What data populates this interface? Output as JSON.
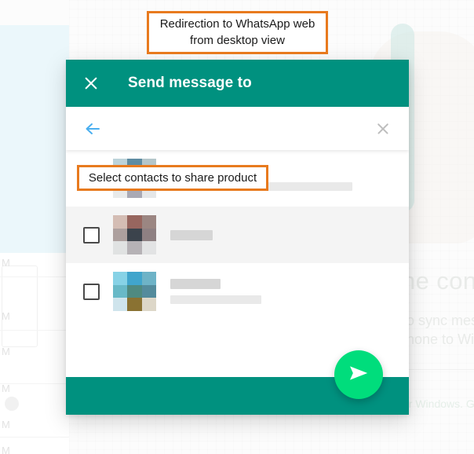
{
  "annotations": {
    "top": "Redirection to WhatsApp web from desktop view",
    "select_contacts": "Select contacts to share product"
  },
  "background": {
    "lines": [
      {
        "text": "he con",
        "size": "big"
      },
      {
        "text": "o sync messag",
        "size": "mid"
      },
      {
        "text": "phone to Wi-",
        "size": "mid"
      },
      {
        "text": "or Windows. G",
        "size": "small"
      }
    ],
    "chat_markers": [
      "M",
      "M",
      "M",
      "M",
      "M",
      "M"
    ]
  },
  "modal": {
    "header": {
      "title": "Send message to",
      "close_icon": "close-icon",
      "bg_color": "#00917f"
    },
    "search": {
      "back_icon": "arrow-left-icon",
      "clear_icon": "close-icon",
      "value": "",
      "placeholder": ""
    },
    "contacts": [
      {
        "checked": true,
        "name_width": 72,
        "sub_width": 232,
        "has_sub": true,
        "avatar": [
          "#bcd3da",
          "#5e8ca2",
          "#b4c6ca",
          "#95b6c0",
          "#44585e",
          "#7c8a86",
          "#e8eaea",
          "#a9a9b4",
          "#e5e7e8"
        ]
      },
      {
        "checked": false,
        "name_width": 54,
        "sub_width": 0,
        "has_sub": false,
        "avatar": [
          "#d4bdb4",
          "#97665f",
          "#9b8682",
          "#ada09e",
          "#3b434c",
          "#8e8082",
          "#e0e2e2",
          "#b6b2b6",
          "#e2e3e4"
        ]
      },
      {
        "checked": false,
        "name_width": 64,
        "sub_width": 116,
        "has_sub": true,
        "avatar": [
          "#87d2e6",
          "#41a5cc",
          "#6eb3c7",
          "#68b9c7",
          "#4f8a80",
          "#548b9c",
          "#cfe4ec",
          "#8a7232",
          "#ddd7c8"
        ]
      }
    ],
    "footer": {
      "bg_color": "#00917f"
    },
    "send_button": {
      "icon": "send-icon",
      "color": "#00dd7c"
    }
  }
}
